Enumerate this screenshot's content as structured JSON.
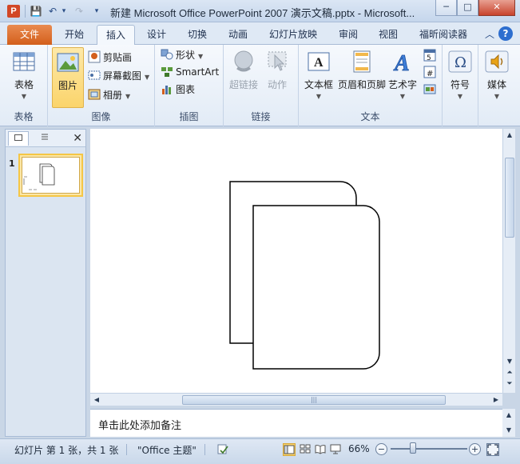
{
  "app_icon_letter": "P",
  "window": {
    "title": "新建 Microsoft Office PowerPoint 2007 演示文稿.pptx - Microsoft...",
    "minimize": "─",
    "maximize": "□",
    "close": "✕"
  },
  "qat": {
    "save": "💾",
    "undo": "↶",
    "undo_caret": "▾",
    "redo": "↷",
    "customize": "▾"
  },
  "tabs": [
    {
      "label": "文件"
    },
    {
      "label": "开始"
    },
    {
      "label": "插入"
    },
    {
      "label": "设计"
    },
    {
      "label": "切换"
    },
    {
      "label": "动画"
    },
    {
      "label": "幻灯片放映"
    },
    {
      "label": "审阅"
    },
    {
      "label": "视图"
    },
    {
      "label": "福昕阅读器"
    }
  ],
  "ribbon_controls": {
    "minimize": "︿",
    "help": "?"
  },
  "groups": {
    "table": {
      "label": "表格",
      "table_btn": "表格"
    },
    "images": {
      "label": "图像",
      "picture_btn": "图片",
      "clipart_btn": "剪贴画",
      "screenshot_btn": "屏幕截图",
      "album_btn": "相册"
    },
    "illustrations": {
      "label": "插图",
      "shapes_btn": "形状",
      "smartart_btn": "SmartArt",
      "chart_btn": "图表"
    },
    "links": {
      "label": "链接",
      "hyperlink_btn": "超链接",
      "action_btn": "动作"
    },
    "text": {
      "label": "文本",
      "textbox_btn": "文本框",
      "header_footer_btn": "页眉和页脚",
      "wordart_btn": "艺术字"
    },
    "symbols": {
      "symbol_btn": "符号"
    },
    "media": {
      "media_btn": "媒体"
    }
  },
  "slide_pane": {
    "close": "✕",
    "slide_number": "1"
  },
  "notes": {
    "placeholder": "单击此处添加备注"
  },
  "statusbar": {
    "slide_info": "幻灯片 第 1 张，共 1 张",
    "theme": "\"Office 主题\"",
    "zoom": "66%",
    "zoom_out": "−",
    "zoom_in": "+"
  },
  "colors": {
    "file_tab": "#d35f1c",
    "selected_button": "#fbd46b",
    "ribbon_bg": "#e2ebf6"
  }
}
